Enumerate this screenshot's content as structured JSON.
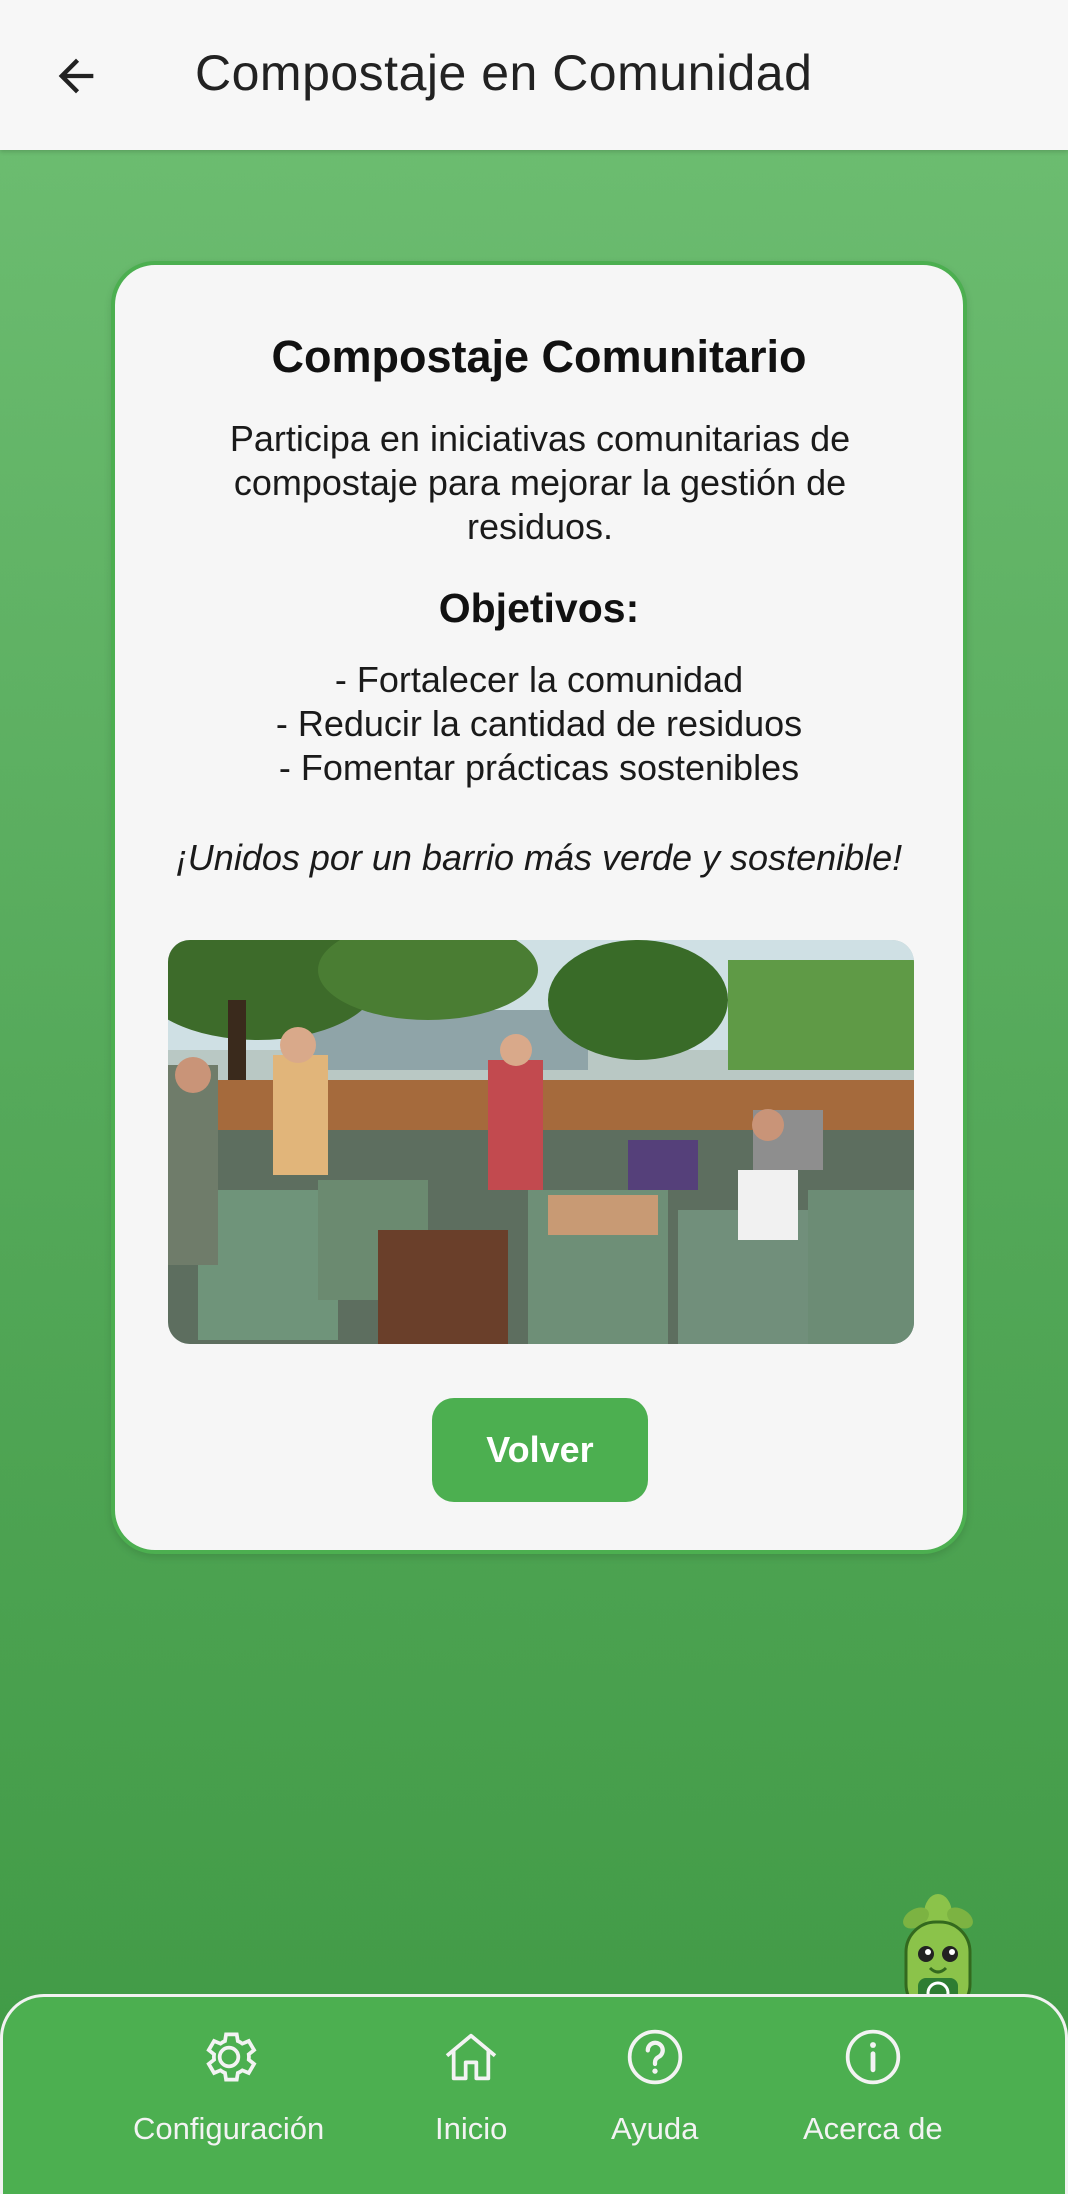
{
  "appbar": {
    "title": "Compostaje en Comunidad",
    "back_icon": "arrow-left-icon"
  },
  "card": {
    "title": "Compostaje Comunitario",
    "description": "Participa en iniciativas comunitarias de compostaje para mejorar la gestión de residuos.",
    "objectives_title": "Objetivos:",
    "objectives": [
      "- Fortalecer la comunidad",
      "- Reducir la cantidad de residuos",
      "- Fomentar prácticas sostenibles"
    ],
    "slogan": "¡Unidos por un barrio más verde y sostenible!",
    "button_label": "Volver"
  },
  "bottom_nav": {
    "items": [
      {
        "label": "Configuración",
        "icon": "gear-icon"
      },
      {
        "label": "Inicio",
        "icon": "home-icon"
      },
      {
        "label": "Ayuda",
        "icon": "help-circle-icon"
      },
      {
        "label": "Acerca de",
        "icon": "info-circle-icon"
      }
    ]
  },
  "colors": {
    "accent": "#4caf50",
    "background_top": "#6fbf73",
    "background_bottom": "#3f9944",
    "card_bg": "#f6f6f6",
    "appbar_bg": "#f7f7f7"
  }
}
